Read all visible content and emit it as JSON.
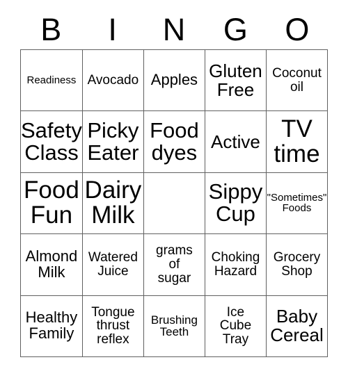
{
  "card": {
    "title": "BINGO",
    "header_letters": [
      "B",
      "I",
      "N",
      "G",
      "O"
    ],
    "columns": 5,
    "rows": 5,
    "free_space": {
      "row": 3,
      "column": 3,
      "label": ""
    },
    "colors": {
      "background": "#ffffff",
      "text": "#000000",
      "grid_line": "#606060"
    },
    "cells": [
      {
        "id": "b1",
        "column": "B",
        "row": 1,
        "text": "Readiness",
        "size": "xs"
      },
      {
        "id": "i1",
        "column": "I",
        "row": 1,
        "text": "Avocado",
        "size": "md"
      },
      {
        "id": "n1",
        "column": "N",
        "row": 1,
        "text": "Apples",
        "size": "lg"
      },
      {
        "id": "g1",
        "column": "G",
        "row": 1,
        "text": "Gluten\nFree",
        "size": "xl"
      },
      {
        "id": "o1",
        "column": "O",
        "row": 1,
        "text": "Coconut\noil",
        "size": "md"
      },
      {
        "id": "b2",
        "column": "B",
        "row": 2,
        "text": "Safety\nClass",
        "size": "xxl"
      },
      {
        "id": "i2",
        "column": "I",
        "row": 2,
        "text": "Picky\nEater",
        "size": "xxl"
      },
      {
        "id": "n2",
        "column": "N",
        "row": 2,
        "text": "Food\ndyes",
        "size": "xxl"
      },
      {
        "id": "g2",
        "column": "G",
        "row": 2,
        "text": "Active",
        "size": "xl"
      },
      {
        "id": "o2",
        "column": "O",
        "row": 2,
        "text": "TV\ntime",
        "size": "huge"
      },
      {
        "id": "b3",
        "column": "B",
        "row": 3,
        "text": "Food\nFun",
        "size": "huge"
      },
      {
        "id": "i3",
        "column": "I",
        "row": 3,
        "text": "Dairy\nMilk",
        "size": "huge"
      },
      {
        "id": "n3",
        "column": "N",
        "row": 3,
        "text": "",
        "size": "md"
      },
      {
        "id": "g3",
        "column": "G",
        "row": 3,
        "text": "Sippy\nCup",
        "size": "xxl"
      },
      {
        "id": "o3",
        "column": "O",
        "row": 3,
        "text": "\"Sometimes\"\nFoods",
        "size": "xs"
      },
      {
        "id": "b4",
        "column": "B",
        "row": 4,
        "text": "Almond\nMilk",
        "size": "lg"
      },
      {
        "id": "i4",
        "column": "I",
        "row": 4,
        "text": "Watered\nJuice",
        "size": "md"
      },
      {
        "id": "n4",
        "column": "N",
        "row": 4,
        "text": "grams\nof\nsugar",
        "size": "md"
      },
      {
        "id": "g4",
        "column": "G",
        "row": 4,
        "text": "Choking\nHazard",
        "size": "md"
      },
      {
        "id": "o4",
        "column": "O",
        "row": 4,
        "text": "Grocery\nShop",
        "size": "md"
      },
      {
        "id": "b5",
        "column": "B",
        "row": 5,
        "text": "Healthy\nFamily",
        "size": "lg"
      },
      {
        "id": "i5",
        "column": "I",
        "row": 5,
        "text": "Tongue\nthrust\nreflex",
        "size": "md"
      },
      {
        "id": "n5",
        "column": "N",
        "row": 5,
        "text": "Brushing\nTeeth",
        "size": "sm"
      },
      {
        "id": "g5",
        "column": "G",
        "row": 5,
        "text": "Ice\nCube\nTray",
        "size": "md"
      },
      {
        "id": "o5",
        "column": "O",
        "row": 5,
        "text": "Baby\nCereal",
        "size": "xl"
      }
    ]
  }
}
